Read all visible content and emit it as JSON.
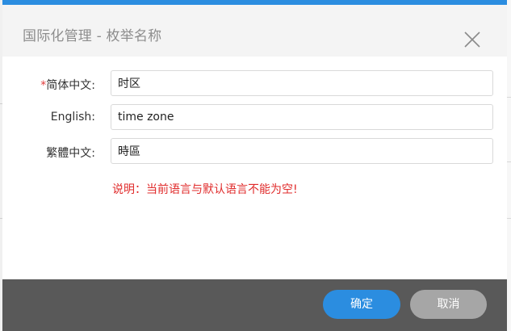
{
  "dialog": {
    "title": "国际化管理 - 枚举名称",
    "colors": {
      "accent": "#2b8de0",
      "header_bg": "#f4f4f4",
      "footer_bg": "#595959",
      "error": "#e02b2b"
    }
  },
  "form": {
    "fields": [
      {
        "required_mark": "*",
        "label": "简体中文:",
        "value": "时区"
      },
      {
        "required_mark": "",
        "label": "English:",
        "value": "time zone"
      },
      {
        "required_mark": "",
        "label": "繁體中文:",
        "value": "時區"
      }
    ],
    "hint": "说明：当前语言与默认语言不能为空!"
  },
  "footer": {
    "confirm_label": "确定",
    "cancel_label": "取消"
  },
  "icons": {
    "close": "close-icon"
  }
}
